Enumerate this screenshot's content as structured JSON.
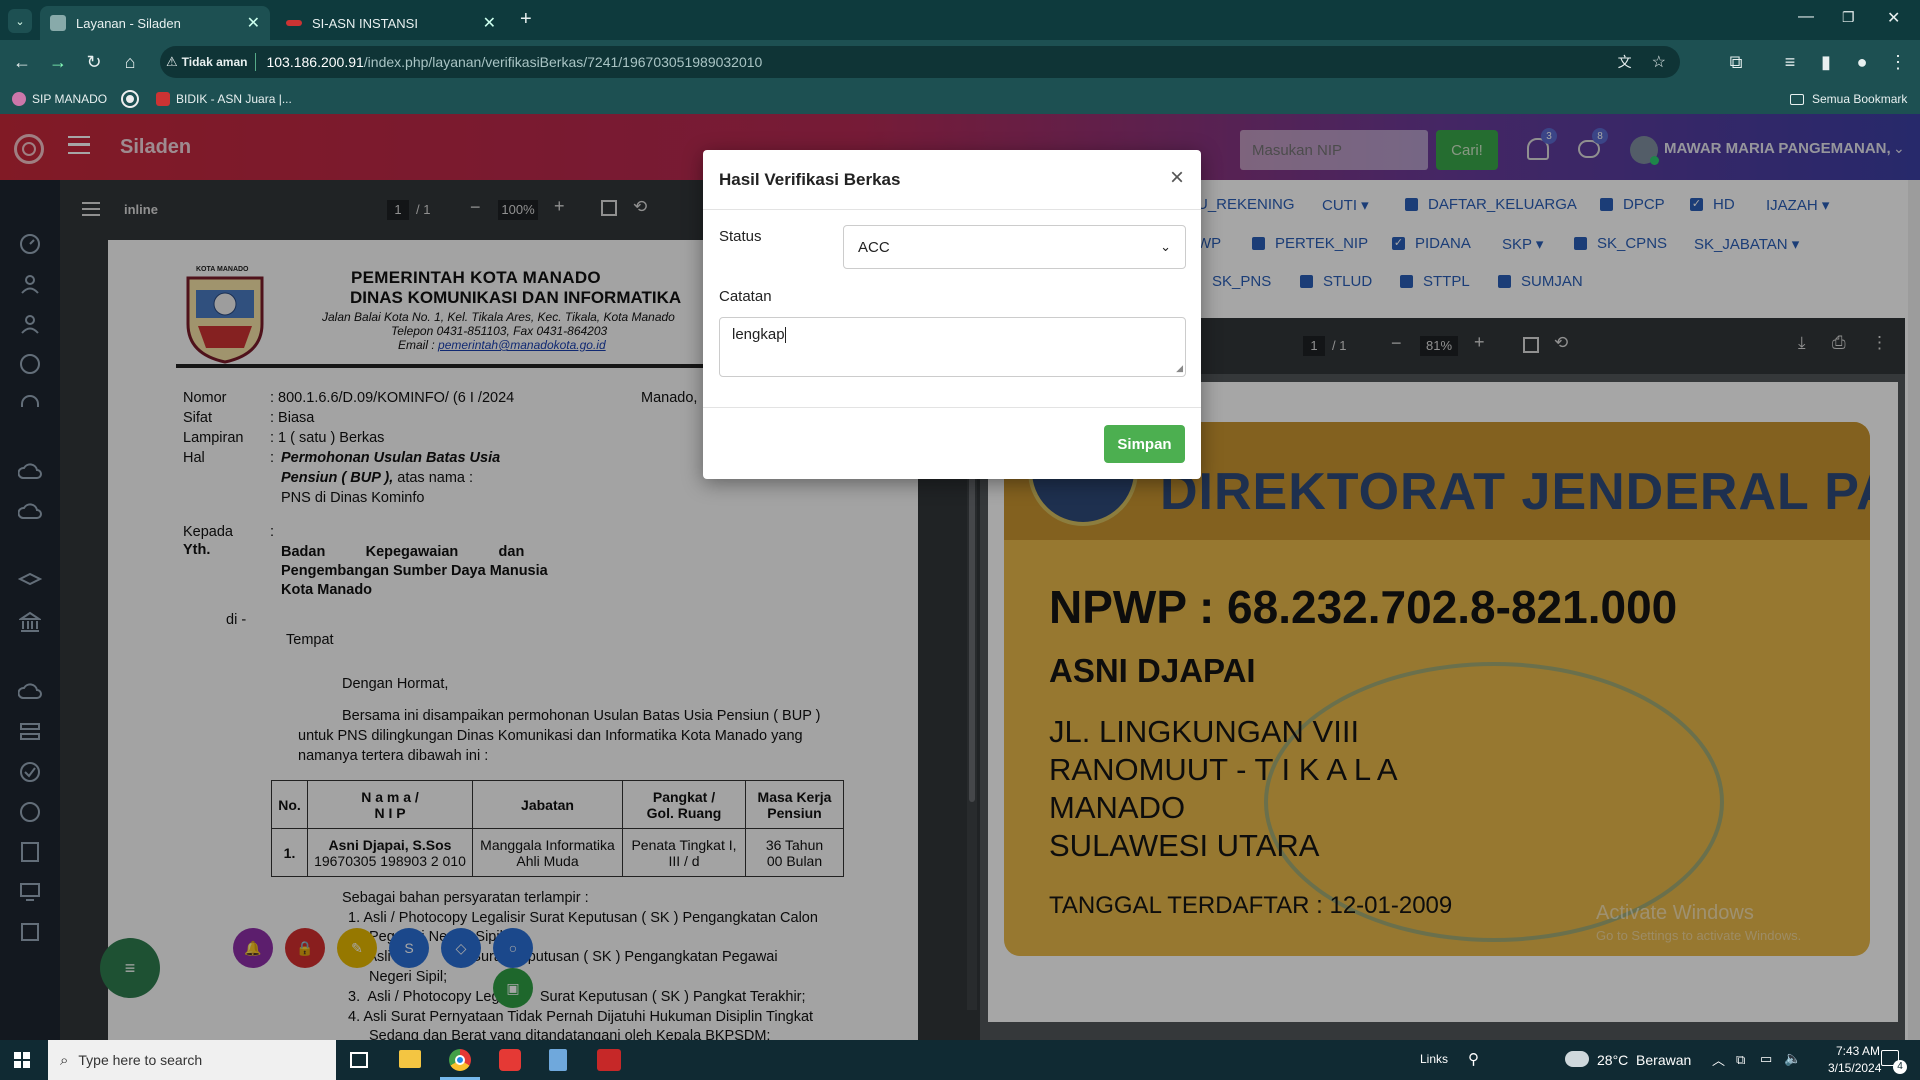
{
  "browser": {
    "tabs": [
      {
        "title": "Layanan - Siladen",
        "active": true
      },
      {
        "title": "SI-ASN INSTANSI",
        "active": false
      }
    ],
    "security_label": "Tidak aman",
    "url_host": "103.186.200.91",
    "url_path": "/index.php/layanan/verifikasiBerkas/7241/196703051989032010",
    "bookmarks": [
      "SIP MANADO",
      "BIDIK - ASN Juara |..."
    ],
    "all_bookmarks": "Semua Bookmark"
  },
  "app": {
    "name": "Siladen",
    "nip_placeholder": "Masukan NIP",
    "search_button": "Cari!",
    "notif_count": "3",
    "msg_count": "8",
    "user_name": "MAWAR MARIA PANGEMANAN,"
  },
  "pdf_left": {
    "filename": "inline",
    "page_current": "1",
    "page_total": "/ 1",
    "zoom": "100%"
  },
  "letter": {
    "org1": "PEMERINTAH KOTA MANADO",
    "org2": "DINAS KOMUNIKASI DAN INFORMATIKA",
    "addr1": "Jalan Balai Kota No. 1, Kel. Tikala Ares, Kec. Tikala, Kota Manado",
    "addr2": "Telepon 0431-851103, Fax 0431-864203",
    "addr3_label": "Email :",
    "addr3_email": "pemerintah@manadokota.go.id",
    "seal_text": "KOTA MANADO",
    "nomor_label": "Nomor",
    "nomor_value": ": 800.1.6.6/D.09/KOMINFO/ (6 I  /2024",
    "city": "Manado,",
    "sifat_label": "Sifat",
    "sifat_value": ": Biasa",
    "lampiran_label": "Lampiran",
    "lampiran_value": ": 1 ( satu ) Berkas",
    "hal_label": "Hal",
    "hal_value1": "Permohonan  Usulan  Batas  Usia",
    "hal_value2": "Pensiun ( BUP ),",
    "hal_value2b": " atas nama :",
    "hal_value3": "PNS di Dinas Kominfo",
    "kepada_label": "Kepada",
    "yth_label": "Yth.",
    "recipient1": "Badan          Kepegawaian          dan",
    "recipient2": "Pengembangan Sumber Daya Manusia",
    "recipient3": "Kota Manado",
    "di": "di -",
    "tempat": "Tempat",
    "greeting": "Dengan Hormat,",
    "body1": "Bersama ini disampaikan permohonan Usulan Batas Usia Pensiun  ( BUP )",
    "body2": "untuk PNS dilingkungan Dinas Komunikasi dan Informatika Kota Manado yang",
    "body3": "namanya tertera dibawah ini :",
    "table_headers": [
      "No.",
      "N a m a /\nN I P",
      "Jabatan",
      "Pangkat /\nGol. Ruang",
      "Masa Kerja\nPensiun"
    ],
    "table_row": {
      "no": "1.",
      "nama": "Asni Djapai, S.Sos",
      "nip": "19670305 198903 2 010",
      "jabatan1": "Manggala Informatika",
      "jabatan2": "Ahli Muda",
      "pangkat1": "Penata Tingkat I,",
      "pangkat2": "III / d",
      "masa1": "36 Tahun",
      "masa2": "00 Bulan"
    },
    "req_intro": "Sebagai bahan persyaratan terlampir :",
    "req1a": "1.  Asli / Photocopy Legalisir Surat Keputusan ( SK ) Pengangkatan Calon",
    "req1b": "Pegawai Negeri Sipil;",
    "req2a": "2.  Asli                    Surat Keputusan ( SK ) Pengangkatan Pegawai",
    "req2b": "Negeri Sipil;",
    "req3": "3.  Asli / Photocopy Leg          Surat Keputusan ( SK ) Pangkat Terakhir;",
    "req4a": "4.  Asli Surat Pernyataan Tidak Pernah Dijatuhi Hukuman Disiplin Tingkat",
    "req4b": "Sedang dan Berat yang ditandatangani oleh Kepala BKPSDM;"
  },
  "doc_tags": {
    "row1": [
      "U_REKENING",
      "CUTI",
      "DAFTAR_KELUARGA",
      "DPCP",
      "HD",
      "IJAZAH"
    ],
    "row2": [
      "WP",
      "PERTEK_NIP",
      "PIDANA",
      "SKP",
      "SK_CPNS",
      "SK_JABATAN"
    ],
    "row3": [
      "SK_PNS",
      "STLUD",
      "STTPL",
      "SUMJAN"
    ]
  },
  "pdf_right": {
    "page_current": "1",
    "page_total": "/ 1",
    "zoom": "81%"
  },
  "npwp_card": {
    "header": "DIREKTORAT JENDERAL PAJAK",
    "npwp": "NPWP  :  68.232.702.8-821.000",
    "name": "ASNI DJAPAI",
    "addr1": "JL. LINGKUNGAN VIII",
    "addr2": "RANOMUUT - T I K A L A",
    "addr3": "MANADO",
    "addr4": "SULAWESI UTARA",
    "date": "TANGGAL TERDAFTAR : 12-01-2009"
  },
  "watermark": {
    "title": "Activate Windows",
    "subtitle": "Go to Settings to activate Windows."
  },
  "modal": {
    "title": "Hasil Verifikasi Berkas",
    "close": "×",
    "status_label": "Status",
    "status_value": "ACC",
    "catatan_label": "Catatan",
    "catatan_value": "lengkap",
    "submit": "Simpan"
  },
  "taskbar": {
    "search_placeholder": "Type here to search",
    "links": "Links",
    "weather": "28°C  Berawan",
    "time": "7:43 AM",
    "date": "3/15/2024",
    "notif": "4"
  },
  "colors": {
    "accent_green": "#4caf50",
    "header_start": "#c6283a",
    "header_end": "#3c3fa5",
    "tag_blue": "#2a5fb7",
    "card_yellow": "#e8b84a"
  }
}
